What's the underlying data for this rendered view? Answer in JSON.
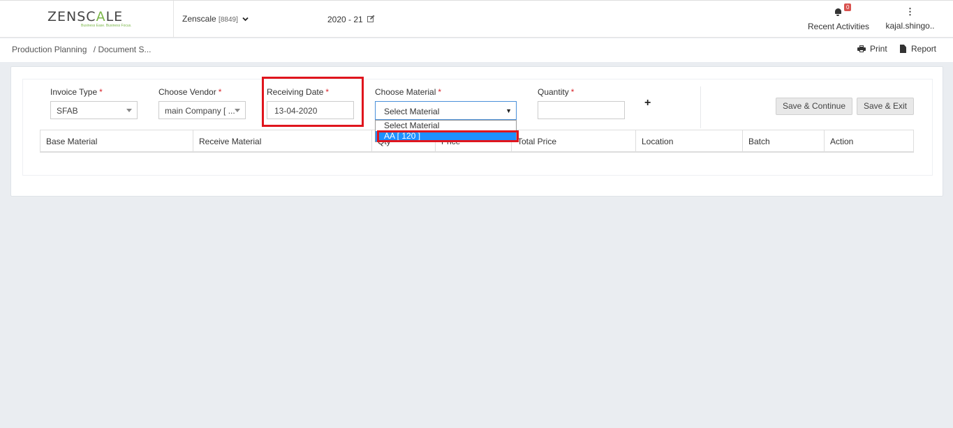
{
  "header": {
    "logo_prefix": "ZENSC",
    "logo_accent": "A",
    "logo_suffix": "LE",
    "logo_tagline": "Business Ease. Business Focus.",
    "company_name": "Zenscale",
    "company_code": "[8849]",
    "fiscal_year": "2020 - 21",
    "notifications_count": "0",
    "recent_activities_label": "Recent Activities",
    "user_name": "kajal.shingo.."
  },
  "breadcrumb": {
    "parent": "Production Planning",
    "separator": "/",
    "current": "Document S..."
  },
  "toolbar": {
    "print_label": "Print",
    "report_label": "Report"
  },
  "form": {
    "invoice_type": {
      "label": "Invoice Type",
      "required": "*",
      "value": "SFAB"
    },
    "vendor": {
      "label": "Choose Vendor",
      "required": "*",
      "value": "main Company [ ..."
    },
    "receiving_date": {
      "label": "Receiving Date",
      "required": "*",
      "value": "13-04-2020"
    },
    "material": {
      "label": "Choose Material",
      "required": "*",
      "value": "Select Material",
      "options": [
        "Select Material",
        "AA [ 120 ]"
      ],
      "highlighted_option": "AA [ 120 ]"
    },
    "quantity": {
      "label": "Quantity",
      "required": "*",
      "value": ""
    },
    "add_symbol": "+",
    "save_continue_label": "Save & Continue",
    "save_exit_label": "Save & Exit"
  },
  "table": {
    "columns": [
      "Base Material",
      "Receive Material",
      "Qty",
      "Price",
      "Total Price",
      "Location",
      "Batch",
      "Action"
    ],
    "rows": []
  },
  "colors": {
    "brand_green": "#7ab648",
    "required_red": "#d9242b",
    "highlight_red": "#e0151d",
    "selection_blue": "#1e90ff",
    "badge_red": "#d9534f"
  }
}
